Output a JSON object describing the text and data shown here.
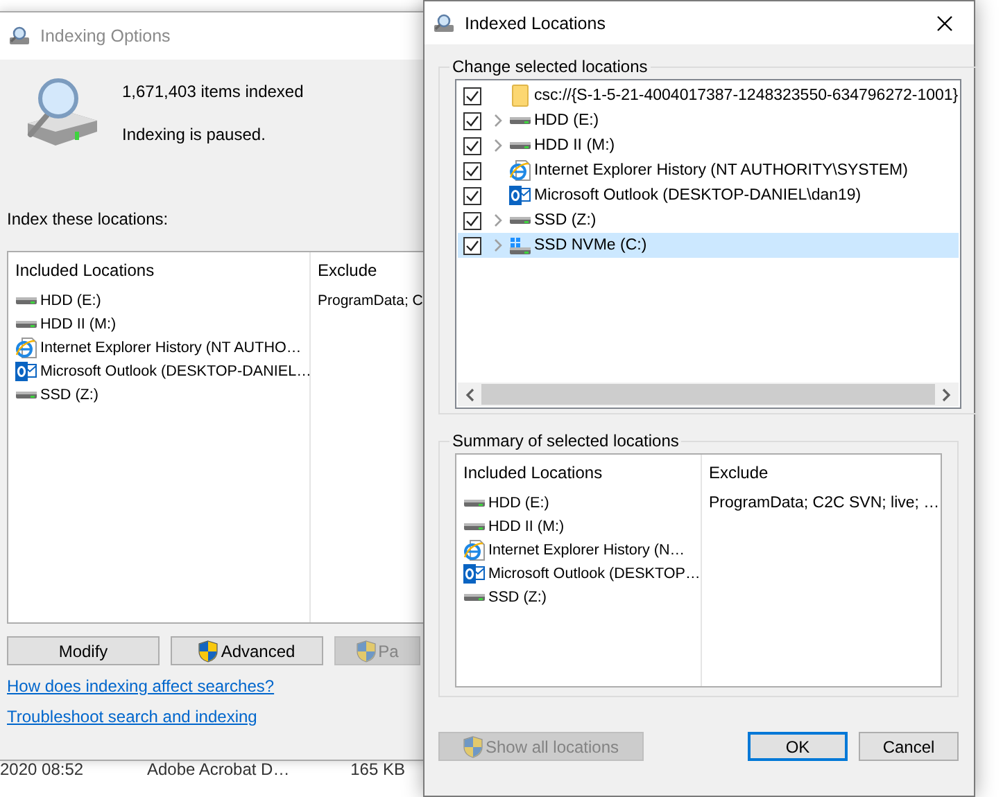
{
  "background_list": {
    "rows": [
      {
        "date": "2020 08:52",
        "name": "Adobe Acrobat D…",
        "size": "165 KB"
      }
    ]
  },
  "indexing_options": {
    "title": "Indexing Options",
    "active": false,
    "items_indexed": "1,671,403 items indexed",
    "status": "Indexing is paused.",
    "locations_label": "Index these locations:",
    "locations_table": {
      "columns": [
        "Included Locations",
        "Exclude"
      ],
      "rows": [
        {
          "kind": "drive",
          "name": "HDD (E:)",
          "exclude": "ProgramData; C"
        },
        {
          "kind": "drive",
          "name": "HDD II (M:)"
        },
        {
          "kind": "web-history",
          "name": "Internet Explorer History (NT AUTHO…"
        },
        {
          "kind": "mail",
          "name": "Microsoft Outlook (DESKTOP-DANIEL…"
        },
        {
          "kind": "drive",
          "name": "SSD (Z:)"
        }
      ]
    },
    "buttons": [
      {
        "label": "Modify",
        "shield": false,
        "disabled": false
      },
      {
        "label": "Advanced",
        "shield": true,
        "disabled": false
      },
      {
        "label": "Pa",
        "shield": true,
        "disabled": true
      }
    ],
    "links": [
      "How does indexing affect searches?",
      "Troubleshoot search and indexing"
    ]
  },
  "indexed_locations": {
    "title": "Indexed Locations",
    "active": true,
    "change_group": {
      "label": "Change selected locations",
      "tree": [
        {
          "kind": "folder",
          "name": "csc://{S-1-5-21-4004017387-1248323550-634796272-1001}",
          "checked": true,
          "expandable": false,
          "selected": false
        },
        {
          "kind": "drive",
          "name": "HDD (E:)",
          "checked": true,
          "expandable": true,
          "selected": false
        },
        {
          "kind": "drive",
          "name": "HDD II (M:)",
          "checked": true,
          "expandable": true,
          "selected": false
        },
        {
          "kind": "web-history",
          "name": "Internet Explorer History (NT AUTHORITY\\SYSTEM)",
          "checked": true,
          "expandable": false,
          "selected": false
        },
        {
          "kind": "mail",
          "name": "Microsoft Outlook (DESKTOP-DANIEL\\dan19)",
          "checked": true,
          "expandable": false,
          "selected": false
        },
        {
          "kind": "drive",
          "name": "SSD (Z:)",
          "checked": true,
          "expandable": true,
          "selected": false
        },
        {
          "kind": "system-drive",
          "name": "SSD NVMe (C:)",
          "checked": true,
          "expandable": true,
          "selected": true
        }
      ]
    },
    "summary_group": {
      "label": "Summary of selected locations",
      "columns": [
        "Included Locations",
        "Exclude"
      ],
      "rows": [
        {
          "kind": "drive",
          "name": "HDD (E:)",
          "exclude": "ProgramData; C2C SVN; live; …"
        },
        {
          "kind": "drive",
          "name": "HDD II (M:)"
        },
        {
          "kind": "web-history",
          "name": "Internet Explorer History (N…"
        },
        {
          "kind": "mail",
          "name": "Microsoft Outlook (DESKTOP…"
        },
        {
          "kind": "drive",
          "name": "SSD (Z:)"
        }
      ]
    },
    "buttons": [
      {
        "label": "Show all locations",
        "shield": true,
        "disabled": true,
        "default": false
      },
      {
        "label": "OK",
        "shield": false,
        "disabled": false,
        "default": true
      },
      {
        "label": "Cancel",
        "shield": false,
        "disabled": false,
        "default": false
      }
    ]
  }
}
